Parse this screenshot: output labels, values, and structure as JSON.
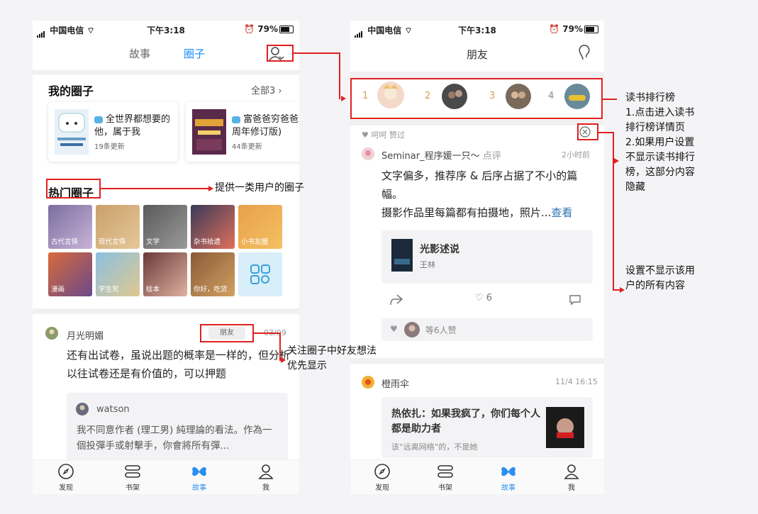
{
  "status": {
    "carrier": "中国电信",
    "time": "下午3:18",
    "battery": "79%"
  },
  "left": {
    "tabs": [
      "故事",
      "圈子"
    ],
    "my_circles": {
      "title": "我的圈子",
      "all": "全部3",
      "cards": [
        {
          "title": "全世界都想要的他，属于我",
          "meta": "19条更新"
        },
        {
          "title": "富爸爸穷爸爸20周年修订版)",
          "meta": "44条更新"
        }
      ]
    },
    "hot": {
      "title": "热门圈子",
      "tiles": [
        "古代言情",
        "现代言情",
        "文学",
        "杂书拾遗",
        "小书友圈",
        "漫画",
        "学生党",
        "绘本",
        "你好，吃货"
      ]
    },
    "post": {
      "user": "月光明媚",
      "badge": "朋友",
      "date": "03/09",
      "text": "还有出试卷，虽说出题的概率是一样的，但分析以往试卷还是有价值的，可以押题",
      "quote_user": "watson",
      "quote_text": "我不同意作者 (理工男) 純理論的看法。作為一個投彈手或射擊手，你會將所有彈..."
    }
  },
  "right": {
    "title": "朋友",
    "ranks": [
      "1",
      "2",
      "3",
      "4"
    ],
    "post1": {
      "liked_by": "呵呵",
      "liked_label": "赞过",
      "user": "Seminar_程序媛一只～",
      "action": "点评",
      "time": "2小时前",
      "text1": "文字偏多，推荐序 & 后序占据了不小的篇幅。",
      "text2": "摄影作品里每篇都有拍摄地，照片...",
      "more": "查看",
      "book_title": "光影述说",
      "book_author": "王林",
      "likes": "6",
      "liked_summary": "等6人赞"
    },
    "post2": {
      "user": "橙雨伞",
      "time": "11/4 16:15",
      "title": "热依扎：如果我疯了，你们每个人都是助力者",
      "sub": "该“远离网络”的，不是她"
    }
  },
  "bottom_nav": [
    "发现",
    "书架",
    "故事",
    "我"
  ],
  "annotations": {
    "hot": "提供一类用户的圈子",
    "friend": "关注圈子中好友想法优先显示",
    "rank": "读书排行榜\n1.点击进入读书排行榜详情页\n2.如果用户设置不显示读书排行榜，这部分内容隐藏",
    "hide": "设置不显示该用户的所有内容"
  },
  "colors": {
    "accent": "#1a8cff",
    "annotation": "#e02020",
    "nav_active": "#2a8ff0"
  }
}
